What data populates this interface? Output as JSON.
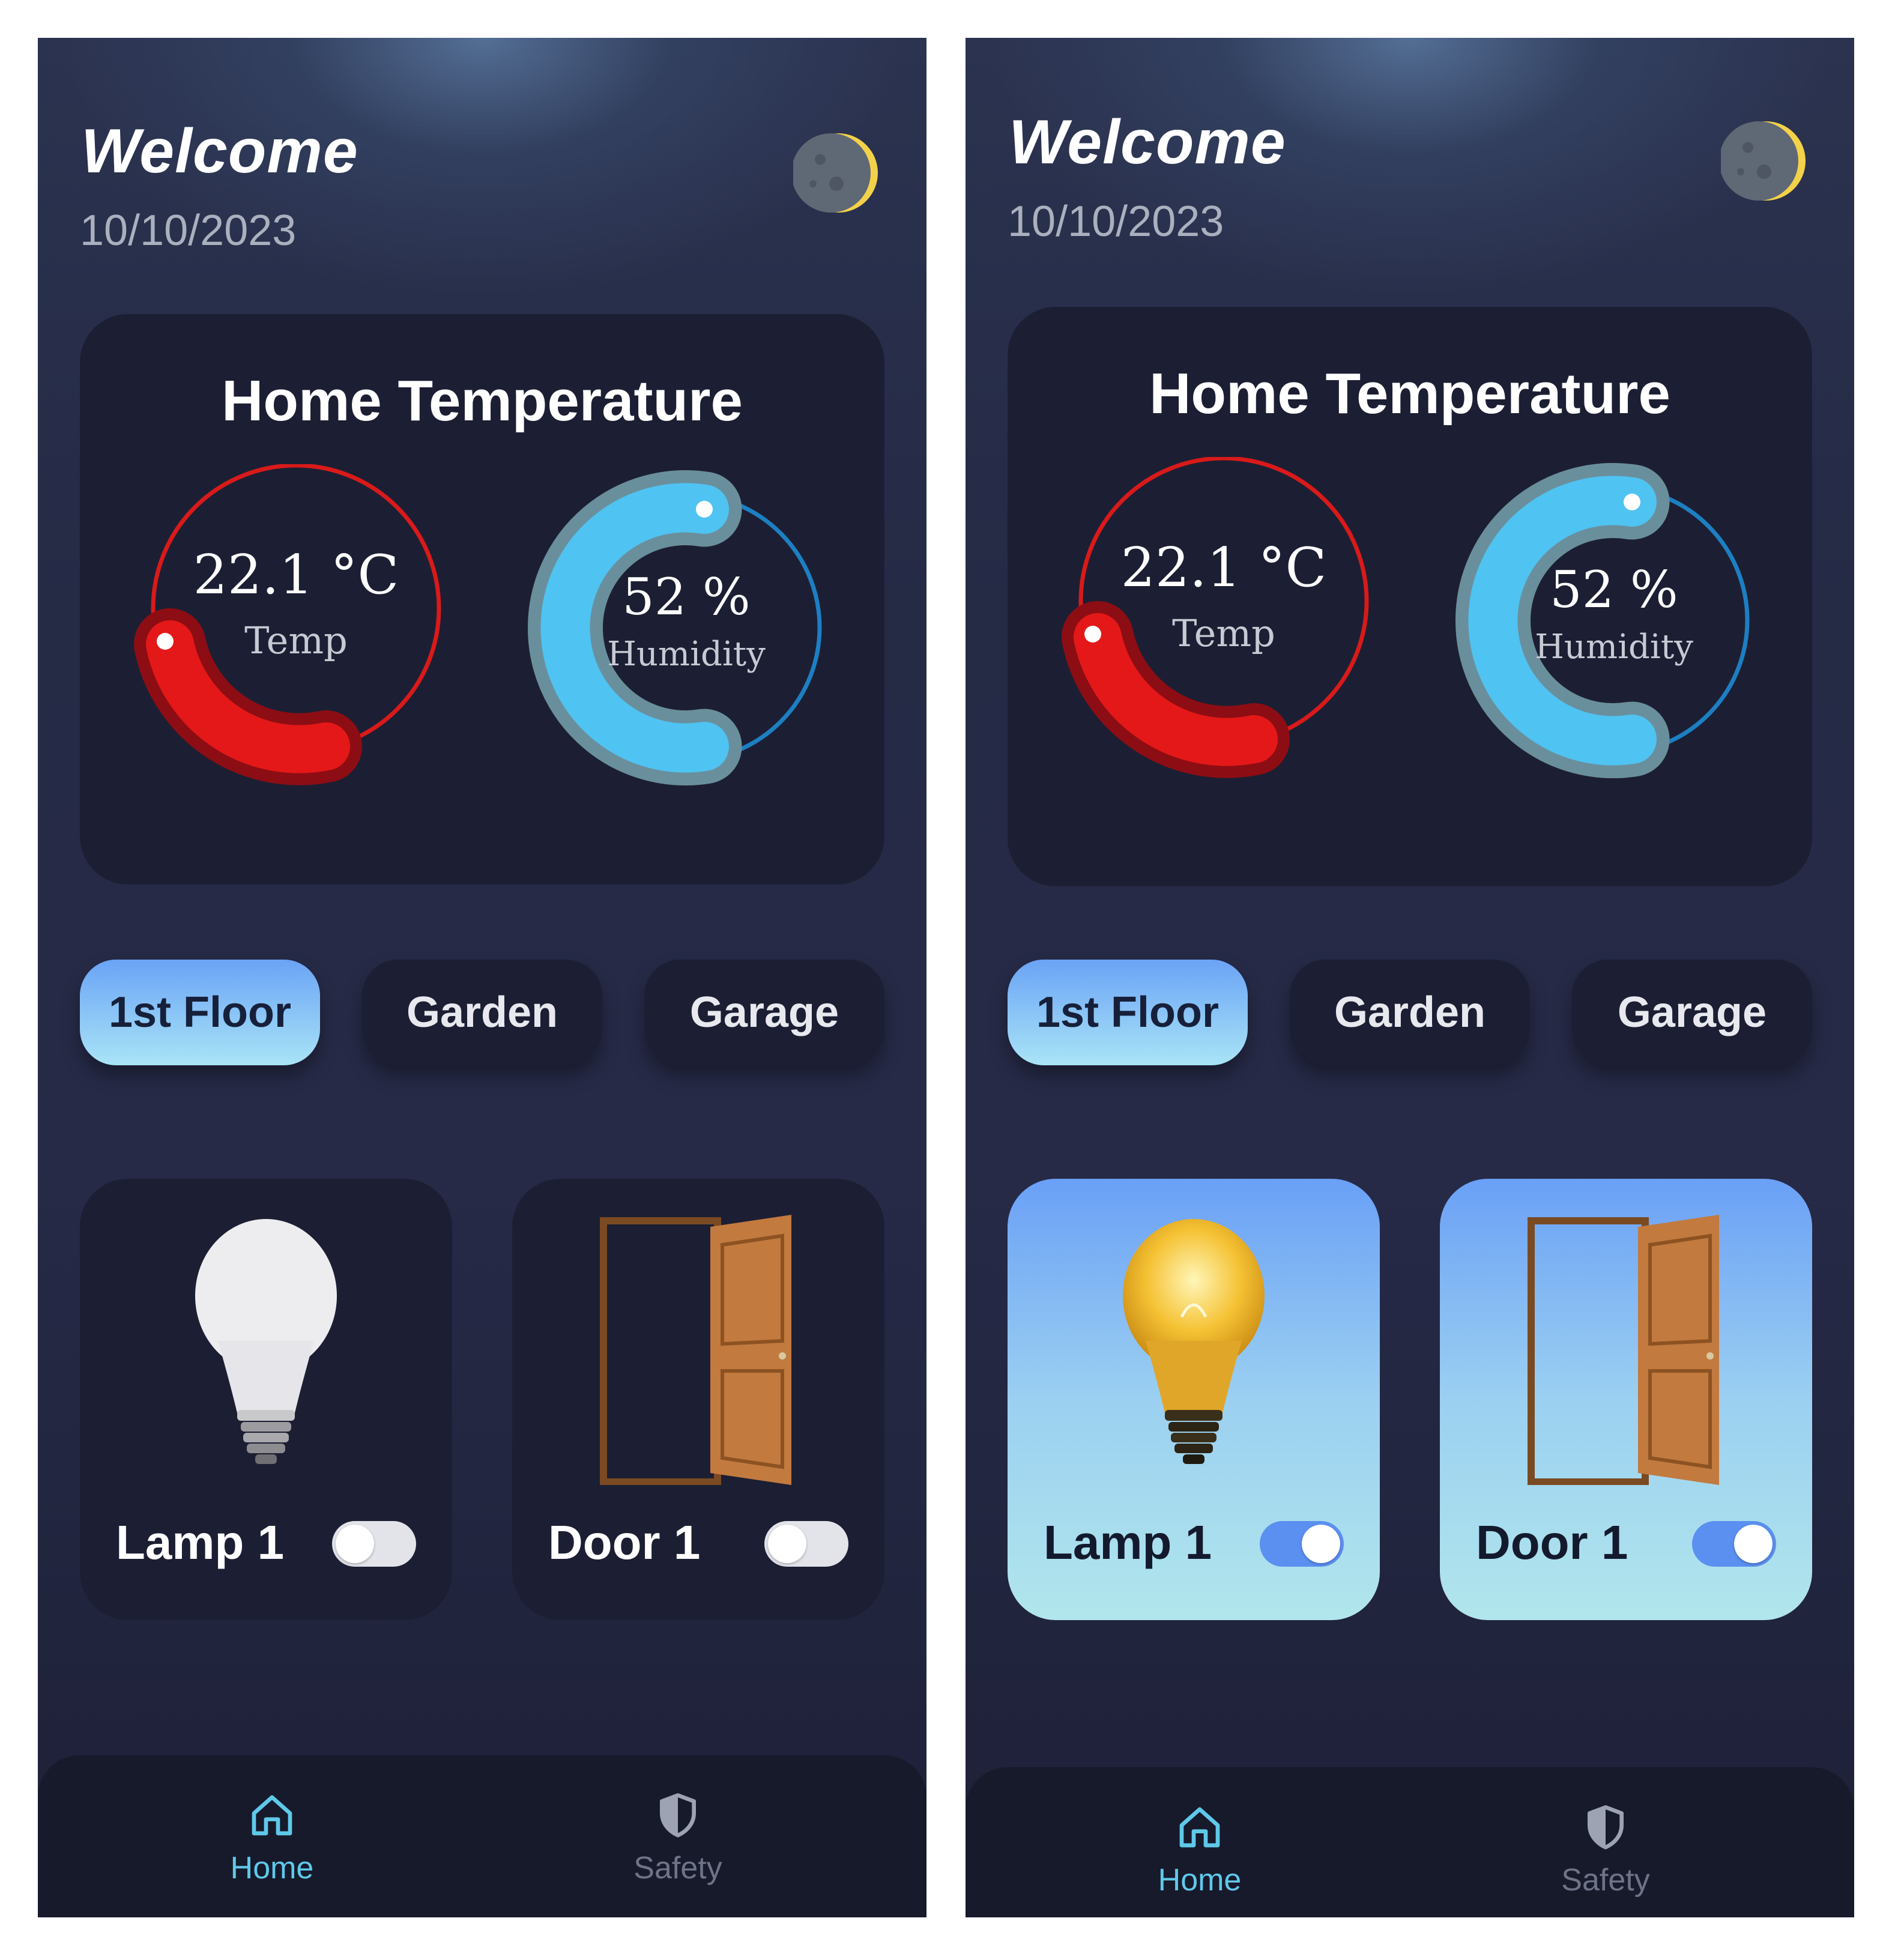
{
  "screens": [
    {
      "welcome": "Welcome",
      "date": "10/10/2023",
      "card_title": "Home Temperature",
      "temperature": {
        "value": "22.1 °C",
        "label": "Temp"
      },
      "humidity": {
        "value": "52 %",
        "label": "Humidity",
        "percent": 52
      },
      "tabs": [
        "1st Floor",
        "Garden",
        "Garage"
      ],
      "active_tab": "1st Floor",
      "devices": [
        {
          "label": "Lamp 1",
          "icon": "lightbulb-icon",
          "on": false
        },
        {
          "label": "Door 1",
          "icon": "door-icon",
          "on": false
        }
      ],
      "nav": [
        {
          "label": "Home",
          "icon": "home-icon"
        },
        {
          "label": "Safety",
          "icon": "shield-icon"
        }
      ]
    },
    {
      "welcome": "Welcome",
      "date": "10/10/2023",
      "card_title": "Home Temperature",
      "temperature": {
        "value": "22.1 °C",
        "label": "Temp"
      },
      "humidity": {
        "value": "52 %",
        "label": "Humidity",
        "percent": 52
      },
      "tabs": [
        "1st Floor",
        "Garden",
        "Garage"
      ],
      "active_tab": "1st Floor",
      "devices": [
        {
          "label": "Lamp 1",
          "icon": "lightbulb-icon",
          "on": true
        },
        {
          "label": "Door 1",
          "icon": "door-icon",
          "on": true
        }
      ],
      "nav": [
        {
          "label": "Home",
          "icon": "home-icon"
        },
        {
          "label": "Safety",
          "icon": "shield-icon"
        }
      ]
    }
  ],
  "colors": {
    "background": "#262a47",
    "card": "#1c1f33",
    "temp_gauge": "#e01515",
    "humidity_gauge": "#4fc3f2",
    "accent": "#5fc9ea",
    "toggle_on": "#5b8ff0"
  }
}
